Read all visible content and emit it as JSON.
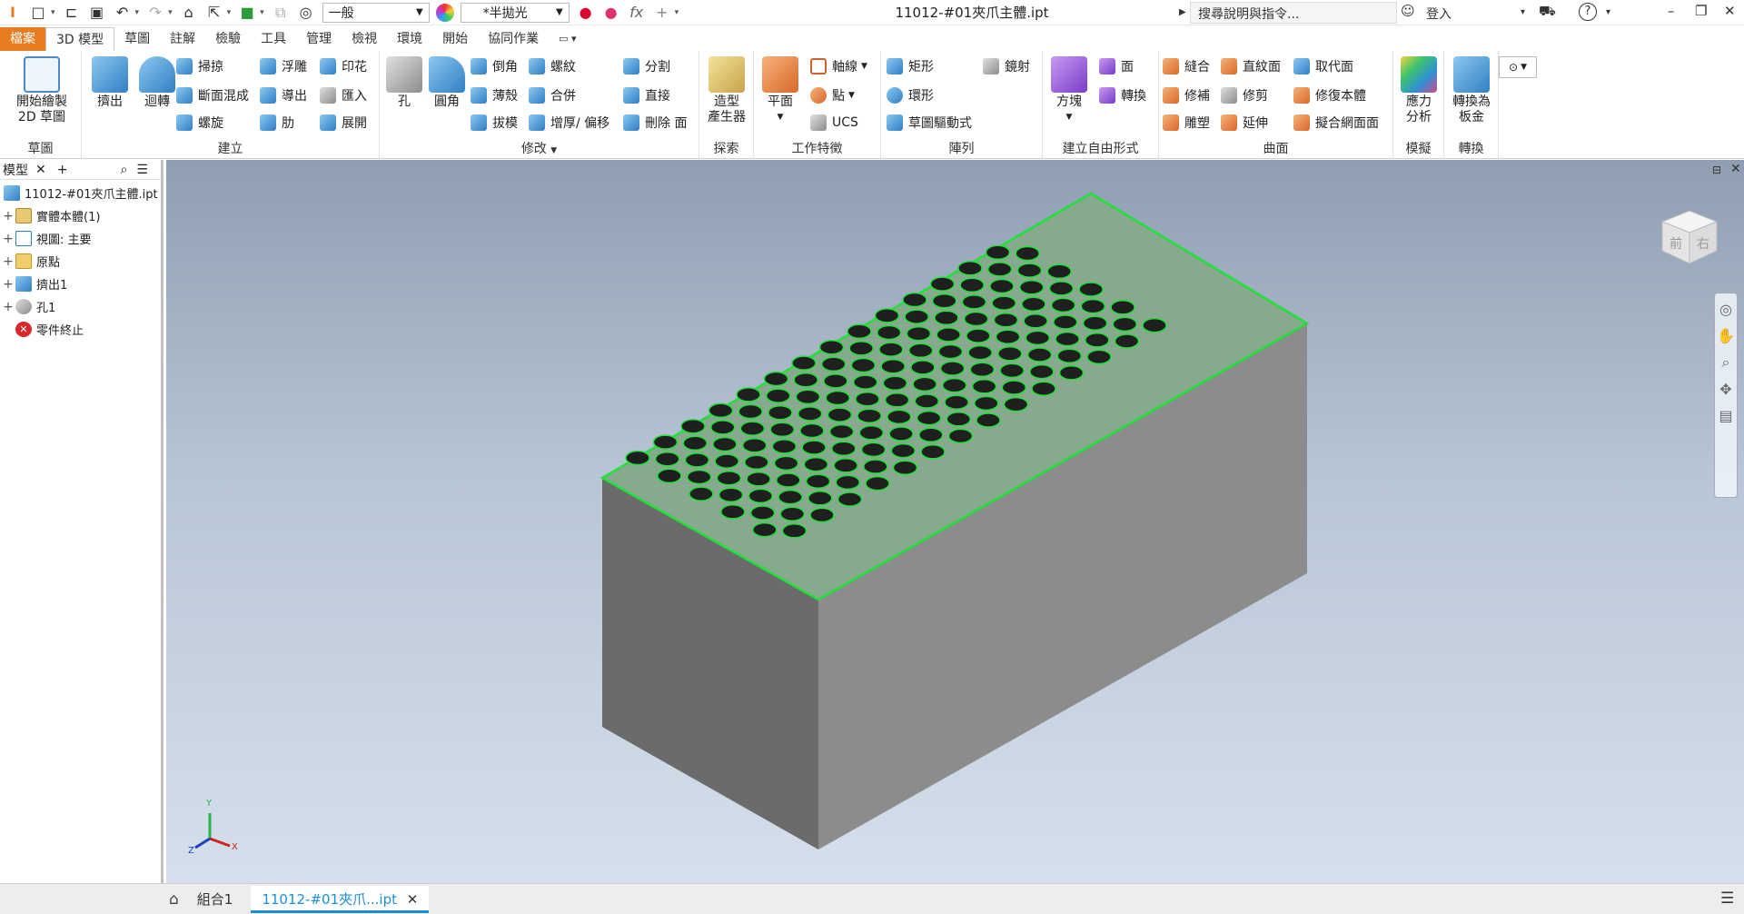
{
  "titlebar": {
    "app_icon": "inventor-pro-icon",
    "style_combo": "一般",
    "appearance_combo": "*半拋光",
    "fx_label": "fx",
    "doc_title": "11012-#01夾爪主體.ipt",
    "search_placeholder": "搜尋說明與指令...",
    "sign_in": "登入",
    "help_label": "?"
  },
  "tabs": [
    "檔案",
    "3D 模型",
    "草圖",
    "註解",
    "檢驗",
    "工具",
    "管理",
    "檢視",
    "環境",
    "開始",
    "協同作業"
  ],
  "ribbon": {
    "sketch": {
      "start_sketch_line1": "開始繪製",
      "start_sketch_line2": "2D 草圖",
      "title": "草圖"
    },
    "create": {
      "extrude": "擠出",
      "revolve": "迴轉",
      "sweep": "掃掠",
      "loft": "斷面混成",
      "coil": "螺旋",
      "emboss": "浮雕",
      "derive": "導出",
      "rib": "肋",
      "decal": "印花",
      "import": "匯入",
      "unfold": "展開",
      "title": "建立"
    },
    "modify": {
      "hole": "孔",
      "fillet": "圓角",
      "chamfer": "倒角",
      "shell": "薄殼",
      "draft": "拔模",
      "thread": "螺紋",
      "combine": "合併",
      "thicken": "增厚/ 偏移",
      "split": "分割",
      "direct": "直接",
      "delete_face": "刪除 面",
      "title": "修改"
    },
    "explore": {
      "shape_gen_line1": "造型",
      "shape_gen_line2": "產生器",
      "title": "探索"
    },
    "work_features": {
      "plane": "平面",
      "axis": "軸線",
      "point": "點",
      "ucs": "UCS",
      "title": "工作特徵"
    },
    "pattern": {
      "rect": "矩形",
      "circular": "環形",
      "sketch_driven": "草圖驅動式",
      "mirror": "鏡射",
      "title": "陣列"
    },
    "freeform": {
      "box": "方塊",
      "face": "面",
      "convert": "轉換",
      "title": "建立自由形式"
    },
    "surface": {
      "stitch": "縫合",
      "patch": "修補",
      "sculpt": "雕塑",
      "ruled": "直紋面",
      "trim": "修剪",
      "extend": "延伸",
      "replace_face": "取代面",
      "repair": "修復本體",
      "fit_mesh": "擬合網面面",
      "title": "曲面"
    },
    "simulation": {
      "stress_line1": "應力",
      "stress_line2": "分析",
      "title": "模擬"
    },
    "convert": {
      "sheet_line1": "轉換為",
      "sheet_line2": "板金",
      "title": "轉換"
    }
  },
  "browser": {
    "tab_label": "模型",
    "items": [
      {
        "label": "11012-#01夾爪主體.ipt",
        "icon": "part-icon"
      },
      {
        "label": "實體本體(1)",
        "icon": "solid-bodies-icon"
      },
      {
        "label": "視圖: 主要",
        "icon": "view-icon"
      },
      {
        "label": "原點",
        "icon": "origin-folder-icon"
      },
      {
        "label": "擠出1",
        "icon": "extrude-feature-icon"
      },
      {
        "label": "孔1",
        "icon": "hole-feature-icon"
      },
      {
        "label": "零件終止",
        "icon": "end-of-part-icon"
      }
    ]
  },
  "viewcube": {
    "front": "前",
    "right": "右"
  },
  "triad": {
    "x": "X",
    "y": "Y",
    "z": "Z"
  },
  "hole_pattern": {
    "rows": 14,
    "columns": 10,
    "count": 140
  },
  "doctabs": {
    "assembly": "組合1",
    "part": "11012-#01夾爪...ipt"
  },
  "colors": {
    "file_tab": "#e67c1f",
    "top_face": "#87aa8e",
    "edge_highlight": "#22e03a",
    "accent": "#1a8fd6"
  }
}
